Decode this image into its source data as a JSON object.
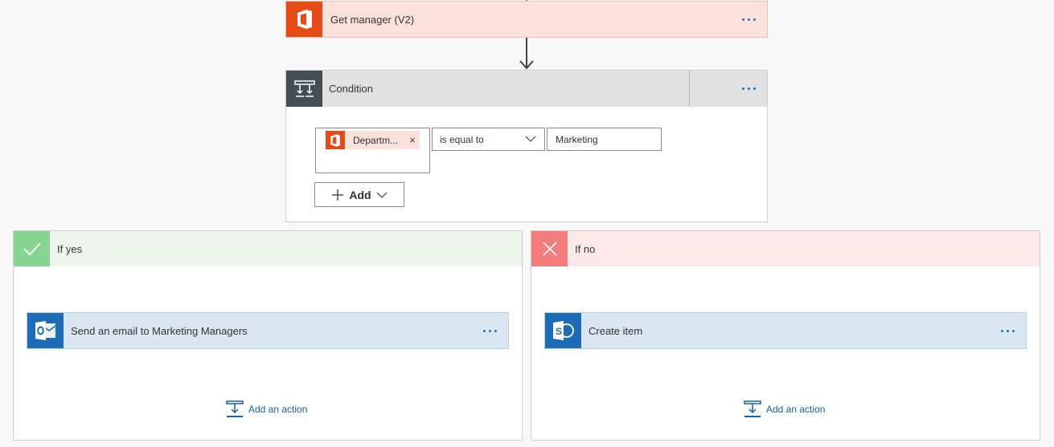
{
  "get_manager": {
    "title": "Get manager (V2)"
  },
  "condition": {
    "title": "Condition",
    "left_token": "Departm...",
    "remove_symbol": "×",
    "operator": "is equal to",
    "value": "Marketing",
    "add_label": "Add"
  },
  "branches": {
    "yes": {
      "title": "If yes",
      "action_title": "Send an email to Marketing Managers",
      "add_action_label": "Add an action"
    },
    "no": {
      "title": "If no",
      "action_title": "Create item",
      "add_action_label": "Add an action"
    }
  },
  "icons": {
    "office": "office-logo-icon",
    "condition": "condition-icon",
    "check": "check-icon",
    "cross": "close-icon",
    "outlook": "outlook-logo-icon",
    "sharepoint": "sharepoint-logo-icon",
    "more": "more-options-icon",
    "add_action": "add-action-icon"
  },
  "colors": {
    "office_orange": "#e64a19",
    "condition_dark": "#454d56",
    "yes_green": "#85d48f",
    "no_red": "#f47c7c",
    "action_blue": "#1e6bb8",
    "link_blue": "#1a5fa0"
  }
}
